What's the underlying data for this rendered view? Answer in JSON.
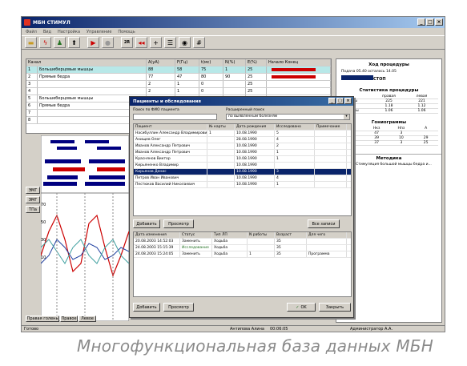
{
  "window": {
    "title": "МБН СТИМУЛ"
  },
  "menu": [
    "Файл",
    "Вид",
    "Настройка",
    "Управление",
    "Помощь"
  ],
  "toolbar": {
    "btn_2r": "2R"
  },
  "channels": {
    "headers": [
      "Канал",
      "A(уА)",
      "F(Гц)",
      "t(мс)",
      "N(%)",
      "E(%)",
      "Начало Конец"
    ],
    "rows": [
      {
        "num": "1",
        "name": "Большеберцовые мышцы",
        "a": "88",
        "f": "58",
        "t": "75",
        "n": "1",
        "e": "25"
      },
      {
        "num": "2",
        "name": "Прямые бедра",
        "a": "77",
        "f": "47",
        "t": "80",
        "n": "90",
        "e": "25"
      },
      {
        "num": "3",
        "name": "",
        "a": "2",
        "f": "1",
        "t": "0",
        "n": "",
        "e": "25"
      },
      {
        "num": "4",
        "name": "",
        "a": "2",
        "f": "1",
        "t": "0",
        "n": "",
        "e": "25"
      },
      {
        "num": "5",
        "name": "Большеберцовые мышцы",
        "a": "",
        "f": "",
        "t": "",
        "n": "",
        "e": ""
      },
      {
        "num": "6",
        "name": "Прямые бедра",
        "a": "",
        "f": "",
        "t": "",
        "n": "",
        "e": ""
      },
      {
        "num": "7",
        "name": "",
        "a": "",
        "f": "",
        "t": "",
        "n": "",
        "e": ""
      },
      {
        "num": "8",
        "name": "",
        "a": "",
        "f": "",
        "t": "",
        "n": "",
        "e": ""
      }
    ]
  },
  "left_buttons": [
    "ЭМГ",
    "ЭМГ",
    "ТПа"
  ],
  "yaxis": [
    "70",
    "50",
    "30",
    "10"
  ],
  "right_panel": {
    "progress_title": "Ход процедуры",
    "progress_text": "Подача 05.40   осталось 14.05",
    "stop_label": "СТОП",
    "stats_title": "Статистика процедуры",
    "stats_headers": [
      "",
      "правая",
      "левая"
    ],
    "stats_rows": [
      [
        "ы",
        "225",
        "221"
      ],
      [
        "",
        "1.18",
        "1.12"
      ],
      [
        "ры",
        "1.06",
        "1.06"
      ]
    ],
    "angles_title": "Гониограммы",
    "angles_headers": [
      "",
      "Нкз",
      "Нпз",
      "А"
    ],
    "angles_rows": [
      [
        "",
        "47",
        "3",
        ""
      ],
      [
        "",
        "39",
        "10",
        "29"
      ],
      [
        "",
        "37",
        "3",
        "25"
      ]
    ],
    "method_title": "Методика",
    "method_text": "Ходьба: Стимуляция большой мышцы бедра и..."
  },
  "dialog": {
    "title": "Пациенты и обследования",
    "search_label": "Поиск по ФИО пациента",
    "search_value": "",
    "filter_label": "Расширенный поиск",
    "filter_value": "по выявленным болезням",
    "patients_headers": [
      "Пациент",
      "№ карты",
      "Дата рождения",
      "Исследовано",
      "Примечание"
    ],
    "patients": [
      [
        "Насибуллин Александр Владимирович",
        "1",
        "10.08.1990",
        "5",
        ""
      ],
      [
        "Анищев Олег",
        "",
        "28.08.1990",
        "4",
        ""
      ],
      [
        "Иванов Александр Петрович",
        "",
        "10.08.1990",
        "2",
        ""
      ],
      [
        "Иванов Александр Петрович",
        "",
        "10.08.1990",
        "1",
        ""
      ],
      [
        "Краснянов Виктор",
        "",
        "10.08.1990",
        "1",
        ""
      ],
      [
        "Кирьяненко Владимир",
        "",
        "10.08.1990",
        "",
        ""
      ],
      [
        "Кирьянов Денис",
        "",
        "10.08.1990",
        "3",
        ""
      ],
      [
        "Петров Иван Иванович",
        "",
        "10.08.1990",
        "4",
        ""
      ],
      [
        "Пестюков Василий Николаевич",
        "",
        "10.08.1990",
        "1",
        ""
      ]
    ],
    "add_label": "Добавить",
    "view_label": "Просмотр",
    "visits_label": "Все записи",
    "exams_headers": [
      "Дата изменения",
      "Статус",
      "Тип ЛП",
      "N работы",
      "Возраст",
      "Для чего"
    ],
    "exams": [
      [
        "20.08.2003 14:52:03",
        "Заменить",
        "Ходьба",
        "",
        "35",
        ""
      ],
      [
        "24.08.2003 15:15:39",
        "Исследование",
        "Ходьба",
        "",
        "35",
        ""
      ],
      [
        "24.08.2003 15:24:05",
        "Заменить",
        "Ходьба",
        "1",
        "35",
        "Программа"
      ]
    ],
    "add2_label": "Добавить",
    "view2_label": "Просмотр",
    "ok_label": "OK",
    "close_label": "Закрыть"
  },
  "bottom_tabs": [
    "Правая голень",
    "Правое",
    "Левое"
  ],
  "status": {
    "left": "Готово",
    "middle": "Антипова Алина",
    "time": "00:06:05",
    "right": "Администратор А.А."
  },
  "caption": "Многофункциональная база данных МБН",
  "colors": {
    "title_blue": "#0a246a",
    "red": "#cc0000",
    "navy": "#000080",
    "dark_blue": "#0a246a"
  }
}
